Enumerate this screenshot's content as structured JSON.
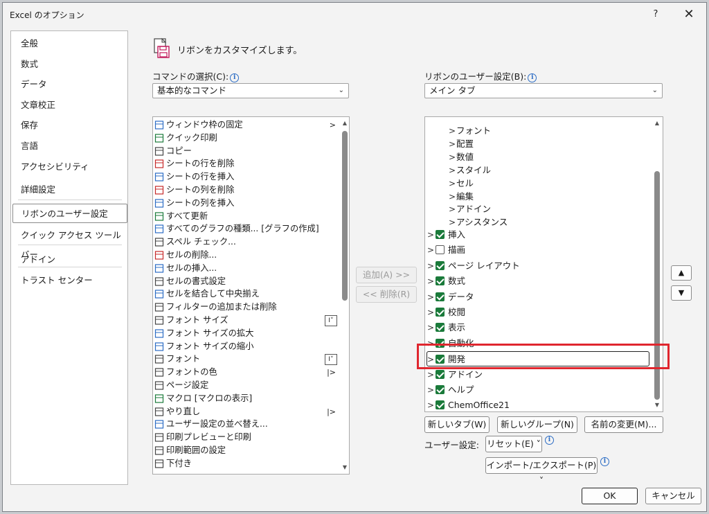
{
  "dialog": {
    "title": "Excel のオプション",
    "help": "?",
    "close": "✕"
  },
  "nav": {
    "items": [
      "全般",
      "数式",
      "データ",
      "文章校正",
      "保存",
      "言語",
      "アクセシビリティ",
      "詳細設定",
      "リボンのユーザー設定",
      "クイック アクセス ツール バー",
      "アドイン",
      "トラスト センター"
    ],
    "selected": "リボンのユーザー設定"
  },
  "header": {
    "text": "リボンをカスタマイズします。"
  },
  "left": {
    "label": "コマンドの選択(C):",
    "combo": "基本的なコマンド",
    "commands": [
      {
        "label": "ウィンドウ枠の固定",
        "right": ">"
      },
      {
        "label": "クイック印刷",
        "right": ""
      },
      {
        "label": "コピー",
        "right": ""
      },
      {
        "label": "シートの行を削除",
        "right": ""
      },
      {
        "label": "シートの行を挿入",
        "right": ""
      },
      {
        "label": "シートの列を削除",
        "right": ""
      },
      {
        "label": "シートの列を挿入",
        "right": ""
      },
      {
        "label": "すべて更新",
        "right": ""
      },
      {
        "label": "すべてのグラフの種類... [グラフの作成]",
        "right": ""
      },
      {
        "label": "スペル チェック...",
        "right": ""
      },
      {
        "label": "セルの削除...",
        "right": ""
      },
      {
        "label": "セルの挿入...",
        "right": ""
      },
      {
        "label": "セルの書式設定",
        "right": ""
      },
      {
        "label": "セルを結合して中央揃え",
        "right": ""
      },
      {
        "label": "フィルターの追加または削除",
        "right": ""
      },
      {
        "label": "フォント サイズ",
        "right": "ibeam"
      },
      {
        "label": "フォント サイズの拡大",
        "right": ""
      },
      {
        "label": "フォント サイズの縮小",
        "right": ""
      },
      {
        "label": "フォント",
        "right": "ibeam"
      },
      {
        "label": "フォントの色",
        "right": "|>"
      },
      {
        "label": "ページ設定",
        "right": ""
      },
      {
        "label": "マクロ [マクロの表示]",
        "right": ""
      },
      {
        "label": "やり直し",
        "right": "|>"
      },
      {
        "label": "ユーザー設定の並べ替え...",
        "right": ""
      },
      {
        "label": "印刷プレビューと印刷",
        "right": ""
      },
      {
        "label": "印刷範囲の設定",
        "right": ""
      },
      {
        "label": "下付き",
        "right": ""
      }
    ]
  },
  "middle": {
    "add": "追加(A) >>",
    "remove": "<< 削除(R)"
  },
  "right": {
    "label": "リボンのユーザー設定(B):",
    "combo": "メイン タブ",
    "subgroups": [
      "フォント",
      "配置",
      "数値",
      "スタイル",
      "セル",
      "編集",
      "アドイン",
      "アシスタンス"
    ],
    "tabs": [
      {
        "label": "挿入",
        "checked": true
      },
      {
        "label": "描画",
        "checked": false
      },
      {
        "label": "ページ レイアウト",
        "checked": true
      },
      {
        "label": "数式",
        "checked": true
      },
      {
        "label": "データ",
        "checked": true
      },
      {
        "label": "校閲",
        "checked": true
      },
      {
        "label": "表示",
        "checked": true
      },
      {
        "label": "自動化",
        "checked": true
      },
      {
        "label": "開発",
        "checked": true
      },
      {
        "label": "アドイン",
        "checked": true
      },
      {
        "label": "ヘルプ",
        "checked": true
      },
      {
        "label": "ChemOffice21",
        "checked": true
      }
    ],
    "new_tab": "新しいタブ(W)",
    "new_group": "新しいグループ(N)",
    "rename": "名前の変更(M)...",
    "user_settings_label": "ユーザー設定:",
    "reset": "リセット(E) ˅",
    "import_export": "インポート/エクスポート(P) ˅",
    "up": "▲",
    "down": "▼"
  },
  "footer": {
    "ok": "OK",
    "cancel": "キャンセル"
  },
  "colors": {
    "highlight": "#e0262e",
    "check": "#1a7a3a",
    "info": "#2b6cc4"
  }
}
